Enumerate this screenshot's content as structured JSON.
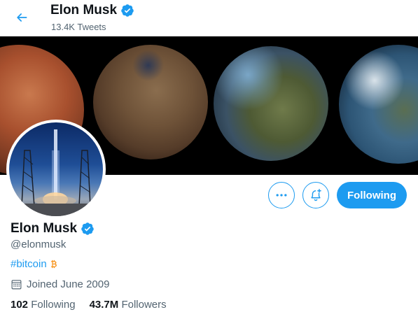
{
  "header": {
    "name": "Elon Musk",
    "tweet_count": "13.4K Tweets"
  },
  "actions": {
    "follow_label": "Following"
  },
  "profile": {
    "name": "Elon Musk",
    "handle": "@elonmusk",
    "bio_hashtag": "#bitcoin",
    "joined": "Joined June 2009",
    "following_count": "102",
    "following_label": "Following",
    "followers_count": "43.7M",
    "followers_label": "Followers"
  },
  "colors": {
    "accent": "#1d9bf0",
    "text": "#0f1419",
    "secondary_text": "#536471",
    "bitcoin": "#f7931a"
  },
  "icons": {
    "back": "arrow-left-icon",
    "verified": "verified-badge-icon",
    "more": "more-dots-icon",
    "notify": "bell-plus-icon",
    "bitcoin": "bitcoin-icon",
    "calendar": "calendar-icon"
  }
}
